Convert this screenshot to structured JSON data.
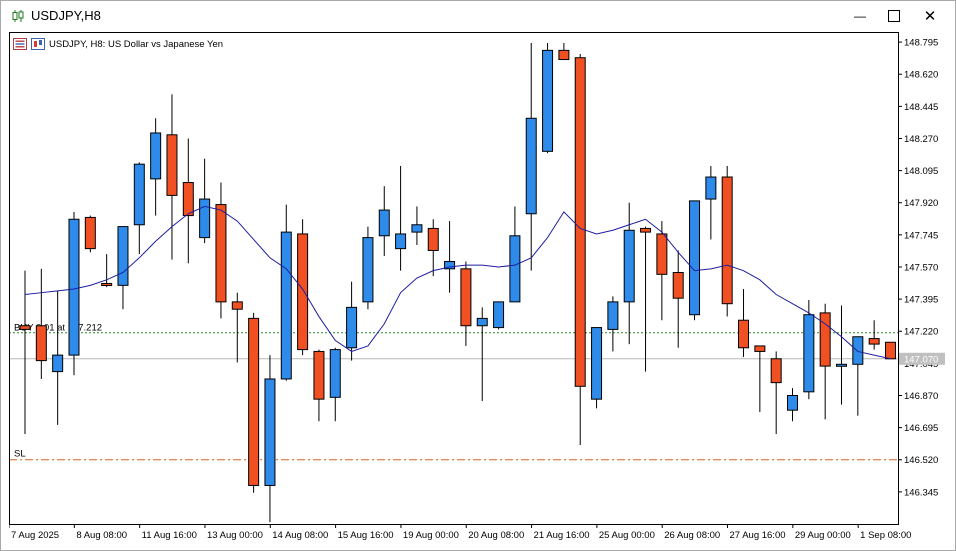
{
  "window": {
    "title": "USDJPY,H8",
    "minimize_glyph": "—",
    "maximize_glyph": "☐",
    "close_glyph": "✕"
  },
  "chart_header": {
    "text": "USDJPY, H8:  US Dollar vs Japanese Yen"
  },
  "icons": [
    "candlestick-app-icon",
    "one-click-trading-icon",
    "chart-properties-icon"
  ],
  "colors": {
    "bull": "#2e8bea",
    "bear": "#f05022",
    "wick": "#000000",
    "ma": "#1d1da0",
    "buy_line": "#2a8a2a",
    "sl_line": "#d0651f",
    "bid_line": "#b8b8b8",
    "price_badge_bg": "#c0c0c0"
  },
  "chart_data": {
    "type": "candlestick",
    "symbol": "USDJPY",
    "timeframe": "H8",
    "ylim": [
      146.17,
      148.85
    ],
    "y_ticks": [
      "148.795",
      "148.620",
      "148.445",
      "148.270",
      "148.095",
      "147.920",
      "147.745",
      "147.570",
      "147.395",
      "147.220",
      "147.045",
      "146.870",
      "146.695",
      "146.520",
      "146.345"
    ],
    "x_ticks": [
      {
        "index": 0,
        "label": "7 Aug 2025"
      },
      {
        "index": 4,
        "label": "8 Aug 08:00"
      },
      {
        "index": 8,
        "label": "11 Aug 16:00"
      },
      {
        "index": 12,
        "label": "13 Aug 00:00"
      },
      {
        "index": 16,
        "label": "14 Aug 08:00"
      },
      {
        "index": 20,
        "label": "15 Aug 16:00"
      },
      {
        "index": 24,
        "label": "19 Aug 00:00"
      },
      {
        "index": 28,
        "label": "20 Aug 08:00"
      },
      {
        "index": 32,
        "label": "21 Aug 16:00"
      },
      {
        "index": 36,
        "label": "25 Aug 00:00"
      },
      {
        "index": 40,
        "label": "26 Aug 08:00"
      },
      {
        "index": 44,
        "label": "27 Aug 16:00"
      },
      {
        "index": 48,
        "label": "29 Aug 00:00"
      },
      {
        "index": 52,
        "label": "1 Sep 08:00"
      }
    ],
    "candles": [
      {
        "o": 147.25,
        "h": 147.55,
        "l": 146.66,
        "c": 147.23
      },
      {
        "o": 147.25,
        "h": 147.56,
        "l": 146.96,
        "c": 147.06
      },
      {
        "o": 147.0,
        "h": 147.44,
        "l": 146.71,
        "c": 147.09
      },
      {
        "o": 147.09,
        "h": 147.87,
        "l": 146.98,
        "c": 147.83
      },
      {
        "o": 147.84,
        "h": 147.85,
        "l": 147.65,
        "c": 147.67
      },
      {
        "o": 147.48,
        "h": 147.64,
        "l": 147.46,
        "c": 147.47
      },
      {
        "o": 147.47,
        "h": 147.79,
        "l": 147.34,
        "c": 147.79
      },
      {
        "o": 147.8,
        "h": 148.14,
        "l": 147.64,
        "c": 148.13
      },
      {
        "o": 148.05,
        "h": 148.38,
        "l": 147.85,
        "c": 148.3
      },
      {
        "o": 148.29,
        "h": 148.51,
        "l": 147.61,
        "c": 147.96
      },
      {
        "o": 148.03,
        "h": 148.27,
        "l": 147.59,
        "c": 147.85
      },
      {
        "o": 147.73,
        "h": 148.16,
        "l": 147.7,
        "c": 147.94
      },
      {
        "o": 147.91,
        "h": 148.03,
        "l": 147.29,
        "c": 147.38
      },
      {
        "o": 147.38,
        "h": 147.43,
        "l": 147.05,
        "c": 147.34
      },
      {
        "o": 147.29,
        "h": 147.32,
        "l": 146.34,
        "c": 146.38
      },
      {
        "o": 146.38,
        "h": 147.09,
        "l": 146.18,
        "c": 146.96
      },
      {
        "o": 146.96,
        "h": 147.91,
        "l": 146.95,
        "c": 147.76
      },
      {
        "o": 147.75,
        "h": 147.83,
        "l": 147.09,
        "c": 147.12
      },
      {
        "o": 147.11,
        "h": 147.12,
        "l": 146.73,
        "c": 146.85
      },
      {
        "o": 146.86,
        "h": 147.13,
        "l": 146.73,
        "c": 147.12
      },
      {
        "o": 147.13,
        "h": 147.49,
        "l": 147.06,
        "c": 147.35
      },
      {
        "o": 147.38,
        "h": 147.79,
        "l": 147.34,
        "c": 147.73
      },
      {
        "o": 147.74,
        "h": 148.01,
        "l": 147.63,
        "c": 147.88
      },
      {
        "o": 147.67,
        "h": 148.12,
        "l": 147.55,
        "c": 147.75
      },
      {
        "o": 147.76,
        "h": 147.9,
        "l": 147.69,
        "c": 147.8
      },
      {
        "o": 147.78,
        "h": 147.83,
        "l": 147.52,
        "c": 147.66
      },
      {
        "o": 147.56,
        "h": 147.82,
        "l": 147.43,
        "c": 147.6
      },
      {
        "o": 147.56,
        "h": 147.6,
        "l": 147.14,
        "c": 147.25
      },
      {
        "o": 147.25,
        "h": 147.35,
        "l": 146.84,
        "c": 147.29
      },
      {
        "o": 147.24,
        "h": 147.37,
        "l": 147.23,
        "c": 147.38
      },
      {
        "o": 147.38,
        "h": 147.9,
        "l": 147.38,
        "c": 147.74
      },
      {
        "o": 147.86,
        "h": 148.79,
        "l": 147.55,
        "c": 148.38
      },
      {
        "o": 148.2,
        "h": 148.79,
        "l": 148.19,
        "c": 148.75
      },
      {
        "o": 148.75,
        "h": 148.79,
        "l": 148.71,
        "c": 148.7
      },
      {
        "o": 148.71,
        "h": 148.73,
        "l": 146.6,
        "c": 146.92
      },
      {
        "o": 146.85,
        "h": 147.23,
        "l": 146.8,
        "c": 147.24
      },
      {
        "o": 147.23,
        "h": 147.41,
        "l": 147.11,
        "c": 147.38
      },
      {
        "o": 147.38,
        "h": 147.92,
        "l": 147.15,
        "c": 147.77
      },
      {
        "o": 147.78,
        "h": 147.79,
        "l": 147.0,
        "c": 147.76
      },
      {
        "o": 147.75,
        "h": 147.82,
        "l": 147.28,
        "c": 147.53
      },
      {
        "o": 147.54,
        "h": 147.66,
        "l": 147.13,
        "c": 147.4
      },
      {
        "o": 147.31,
        "h": 147.92,
        "l": 147.28,
        "c": 147.93
      },
      {
        "o": 147.94,
        "h": 148.12,
        "l": 147.72,
        "c": 148.06
      },
      {
        "o": 148.06,
        "h": 148.12,
        "l": 147.3,
        "c": 147.37
      },
      {
        "o": 147.28,
        "h": 147.45,
        "l": 147.08,
        "c": 147.13
      },
      {
        "o": 147.14,
        "h": 147.14,
        "l": 146.78,
        "c": 147.11
      },
      {
        "o": 147.07,
        "h": 147.11,
        "l": 146.66,
        "c": 146.94
      },
      {
        "o": 146.79,
        "h": 146.91,
        "l": 146.73,
        "c": 146.87
      },
      {
        "o": 146.89,
        "h": 147.39,
        "l": 146.85,
        "c": 147.31
      },
      {
        "o": 147.32,
        "h": 147.37,
        "l": 146.74,
        "c": 147.03
      },
      {
        "o": 147.03,
        "h": 147.36,
        "l": 146.82,
        "c": 147.04
      },
      {
        "o": 147.04,
        "h": 147.19,
        "l": 146.76,
        "c": 147.19
      },
      {
        "o": 147.18,
        "h": 147.28,
        "l": 147.12,
        "c": 147.15
      },
      {
        "o": 147.16,
        "h": 147.16,
        "l": 147.07,
        "c": 147.07
      }
    ],
    "moving_average": [
      147.42,
      147.43,
      147.44,
      147.45,
      147.47,
      147.5,
      147.54,
      147.62,
      147.71,
      147.79,
      147.86,
      147.9,
      147.88,
      147.82,
      147.72,
      147.62,
      147.56,
      147.45,
      147.3,
      147.17,
      147.11,
      147.14,
      147.26,
      147.43,
      147.51,
      147.55,
      147.57,
      147.58,
      147.58,
      147.57,
      147.58,
      147.62,
      147.73,
      147.87,
      147.78,
      147.75,
      147.77,
      147.8,
      147.83,
      147.76,
      147.65,
      147.55,
      147.56,
      147.58,
      147.55,
      147.5,
      147.42,
      147.37,
      147.32,
      147.26,
      147.19,
      147.11,
      147.09,
      147.07
    ],
    "lines": {
      "buy": {
        "price": 147.212,
        "label": "BUY 0.01 at 147.212"
      },
      "sl": {
        "price": 146.52,
        "label": "SL"
      },
      "bid": {
        "price": 147.07,
        "label": "147.070"
      }
    }
  }
}
